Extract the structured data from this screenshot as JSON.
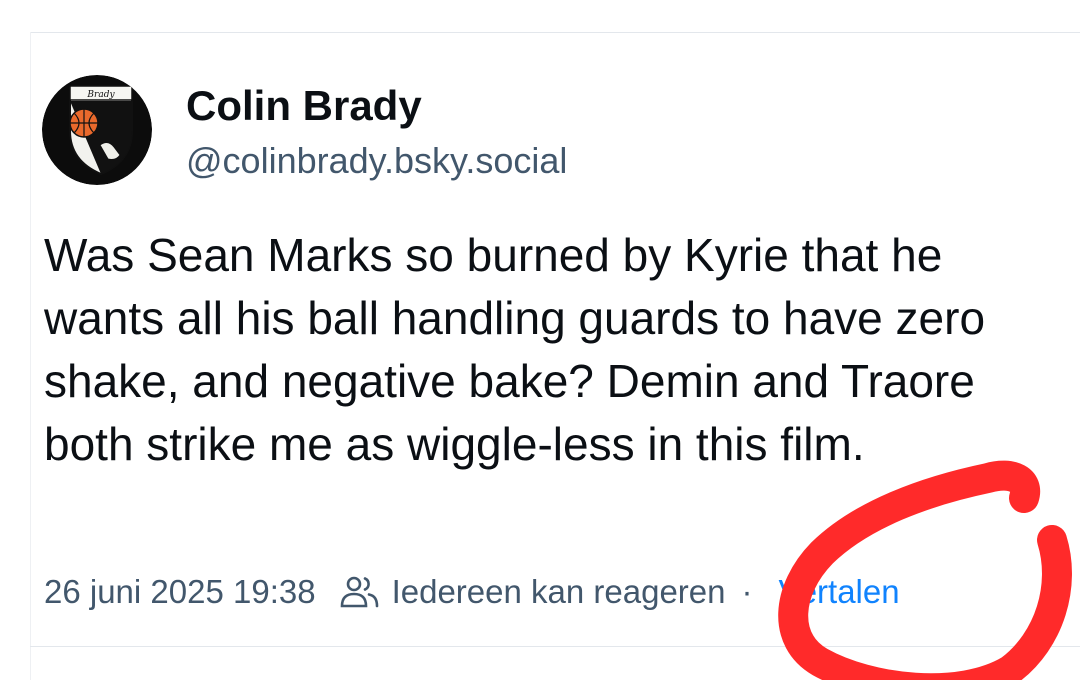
{
  "post": {
    "author": {
      "display_name": "Colin Brady",
      "handle": "@colinbrady.bsky.social",
      "avatar_text": "Brady"
    },
    "text": "Was Sean Marks so burned by Kyrie that he wants all his ball handling guards to have zero shake, and negative bake? Demin and Traore both strike me as wiggle-less in this film.",
    "timestamp": "26 juni 2025 19:38",
    "reply_setting": "Iedereen kan reageren",
    "separator": "·",
    "translate_label": "Vertalen"
  },
  "colors": {
    "text": "#0b0f14",
    "secondary": "#42576c",
    "link": "#1083fe",
    "annotation": "#ff2a2a"
  },
  "icons": {
    "reply_setting": "people-icon"
  }
}
